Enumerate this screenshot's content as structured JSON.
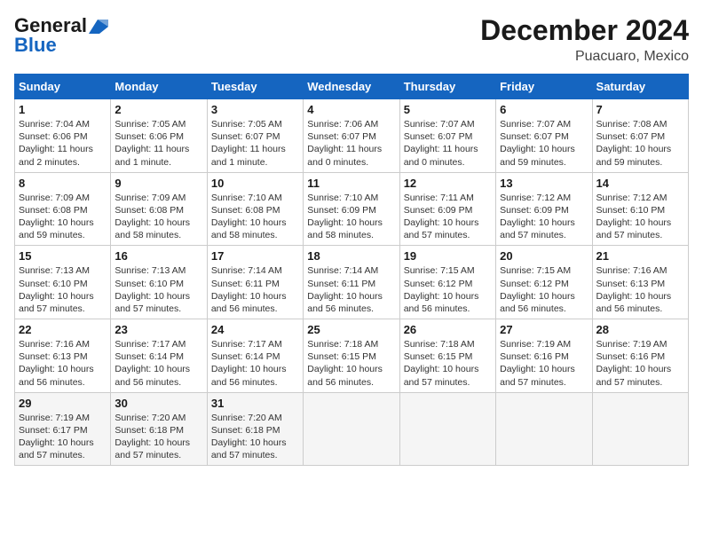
{
  "logo": {
    "line1": "General",
    "line2": "Blue"
  },
  "title": "December 2024",
  "location": "Puacuaro, Mexico",
  "weekdays": [
    "Sunday",
    "Monday",
    "Tuesday",
    "Wednesday",
    "Thursday",
    "Friday",
    "Saturday"
  ],
  "weeks": [
    [
      {
        "day": "1",
        "info": "Sunrise: 7:04 AM\nSunset: 6:06 PM\nDaylight: 11 hours\nand 2 minutes."
      },
      {
        "day": "2",
        "info": "Sunrise: 7:05 AM\nSunset: 6:06 PM\nDaylight: 11 hours\nand 1 minute."
      },
      {
        "day": "3",
        "info": "Sunrise: 7:05 AM\nSunset: 6:07 PM\nDaylight: 11 hours\nand 1 minute."
      },
      {
        "day": "4",
        "info": "Sunrise: 7:06 AM\nSunset: 6:07 PM\nDaylight: 11 hours\nand 0 minutes."
      },
      {
        "day": "5",
        "info": "Sunrise: 7:07 AM\nSunset: 6:07 PM\nDaylight: 11 hours\nand 0 minutes."
      },
      {
        "day": "6",
        "info": "Sunrise: 7:07 AM\nSunset: 6:07 PM\nDaylight: 10 hours\nand 59 minutes."
      },
      {
        "day": "7",
        "info": "Sunrise: 7:08 AM\nSunset: 6:07 PM\nDaylight: 10 hours\nand 59 minutes."
      }
    ],
    [
      {
        "day": "8",
        "info": "Sunrise: 7:09 AM\nSunset: 6:08 PM\nDaylight: 10 hours\nand 59 minutes."
      },
      {
        "day": "9",
        "info": "Sunrise: 7:09 AM\nSunset: 6:08 PM\nDaylight: 10 hours\nand 58 minutes."
      },
      {
        "day": "10",
        "info": "Sunrise: 7:10 AM\nSunset: 6:08 PM\nDaylight: 10 hours\nand 58 minutes."
      },
      {
        "day": "11",
        "info": "Sunrise: 7:10 AM\nSunset: 6:09 PM\nDaylight: 10 hours\nand 58 minutes."
      },
      {
        "day": "12",
        "info": "Sunrise: 7:11 AM\nSunset: 6:09 PM\nDaylight: 10 hours\nand 57 minutes."
      },
      {
        "day": "13",
        "info": "Sunrise: 7:12 AM\nSunset: 6:09 PM\nDaylight: 10 hours\nand 57 minutes."
      },
      {
        "day": "14",
        "info": "Sunrise: 7:12 AM\nSunset: 6:10 PM\nDaylight: 10 hours\nand 57 minutes."
      }
    ],
    [
      {
        "day": "15",
        "info": "Sunrise: 7:13 AM\nSunset: 6:10 PM\nDaylight: 10 hours\nand 57 minutes."
      },
      {
        "day": "16",
        "info": "Sunrise: 7:13 AM\nSunset: 6:10 PM\nDaylight: 10 hours\nand 57 minutes."
      },
      {
        "day": "17",
        "info": "Sunrise: 7:14 AM\nSunset: 6:11 PM\nDaylight: 10 hours\nand 56 minutes."
      },
      {
        "day": "18",
        "info": "Sunrise: 7:14 AM\nSunset: 6:11 PM\nDaylight: 10 hours\nand 56 minutes."
      },
      {
        "day": "19",
        "info": "Sunrise: 7:15 AM\nSunset: 6:12 PM\nDaylight: 10 hours\nand 56 minutes."
      },
      {
        "day": "20",
        "info": "Sunrise: 7:15 AM\nSunset: 6:12 PM\nDaylight: 10 hours\nand 56 minutes."
      },
      {
        "day": "21",
        "info": "Sunrise: 7:16 AM\nSunset: 6:13 PM\nDaylight: 10 hours\nand 56 minutes."
      }
    ],
    [
      {
        "day": "22",
        "info": "Sunrise: 7:16 AM\nSunset: 6:13 PM\nDaylight: 10 hours\nand 56 minutes."
      },
      {
        "day": "23",
        "info": "Sunrise: 7:17 AM\nSunset: 6:14 PM\nDaylight: 10 hours\nand 56 minutes."
      },
      {
        "day": "24",
        "info": "Sunrise: 7:17 AM\nSunset: 6:14 PM\nDaylight: 10 hours\nand 56 minutes."
      },
      {
        "day": "25",
        "info": "Sunrise: 7:18 AM\nSunset: 6:15 PM\nDaylight: 10 hours\nand 56 minutes."
      },
      {
        "day": "26",
        "info": "Sunrise: 7:18 AM\nSunset: 6:15 PM\nDaylight: 10 hours\nand 57 minutes."
      },
      {
        "day": "27",
        "info": "Sunrise: 7:19 AM\nSunset: 6:16 PM\nDaylight: 10 hours\nand 57 minutes."
      },
      {
        "day": "28",
        "info": "Sunrise: 7:19 AM\nSunset: 6:16 PM\nDaylight: 10 hours\nand 57 minutes."
      }
    ],
    [
      {
        "day": "29",
        "info": "Sunrise: 7:19 AM\nSunset: 6:17 PM\nDaylight: 10 hours\nand 57 minutes."
      },
      {
        "day": "30",
        "info": "Sunrise: 7:20 AM\nSunset: 6:18 PM\nDaylight: 10 hours\nand 57 minutes."
      },
      {
        "day": "31",
        "info": "Sunrise: 7:20 AM\nSunset: 6:18 PM\nDaylight: 10 hours\nand 57 minutes."
      },
      {
        "day": "",
        "info": ""
      },
      {
        "day": "",
        "info": ""
      },
      {
        "day": "",
        "info": ""
      },
      {
        "day": "",
        "info": ""
      }
    ]
  ]
}
